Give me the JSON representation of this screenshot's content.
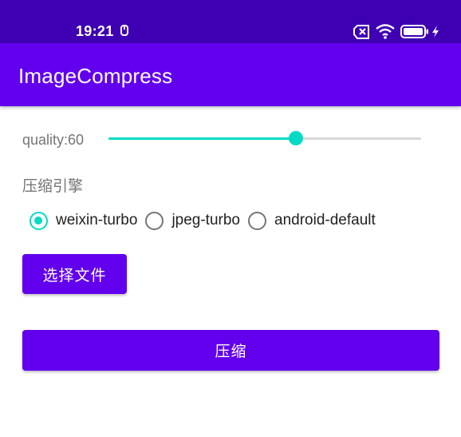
{
  "status_bar": {
    "time": "19:21",
    "icons": [
      "usb-icon",
      "no-sim-icon",
      "wifi-icon",
      "battery-icon",
      "charging-icon"
    ]
  },
  "app_bar": {
    "title": "ImageCompress",
    "color": "#6200ee"
  },
  "quality": {
    "label": "quality:60",
    "value": 60,
    "max": 100,
    "accent": "#03dac5"
  },
  "engine": {
    "label": "压缩引擎",
    "options": [
      {
        "label": "weixin-turbo",
        "checked": true
      },
      {
        "label": "jpeg-turbo",
        "checked": false
      },
      {
        "label": "android-default",
        "checked": false
      }
    ]
  },
  "buttons": {
    "select_file": "选择文件",
    "compress": "压缩"
  }
}
